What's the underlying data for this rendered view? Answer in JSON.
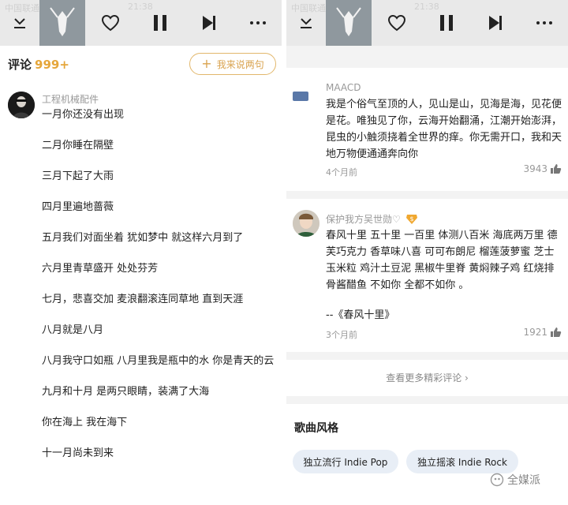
{
  "status_bar": {
    "carrier": "中国联通",
    "time": "21:38"
  },
  "player": {
    "icons": [
      "chevron-down-icon",
      "heart-icon",
      "pause-icon",
      "next-track-icon",
      "more-icon"
    ]
  },
  "left": {
    "comments_label": "评论",
    "comments_count": "999+",
    "say_button": "我来说两句",
    "comment": {
      "user": "工程机械配件",
      "lines": [
        "一月你还没有出现",
        "二月你睡在隔壁",
        "三月下起了大雨",
        "四月里遍地蔷薇",
        "五月我们对面坐着 犹如梦中 就这样六月到了",
        "六月里青草盛开 处处芬芳",
        "七月，悲喜交加 麦浪翻滚连同草地 直到天涯",
        "八月就是八月",
        "八月我守口如瓶 八月里我是瓶中的水 你是青天的云",
        "九月和十月 是两只眼睛，装满了大海",
        "你在海上 我在海下",
        "十一月尚未到来"
      ]
    }
  },
  "right": {
    "comments": [
      {
        "user": "MAACD",
        "text": "我是个俗气至顶的人，见山是山，见海是海，见花便是花。唯独见了你，云海开始翻涌，江潮开始澎湃，昆虫的小触须挠着全世界的痒。你无需开口，我和天地万物便通通奔向你",
        "time": "4个月前",
        "likes": "3943"
      },
      {
        "user": "保护我方吴世勋♡",
        "text": "春风十里 五十里 一百里 体测八百米 海底两万里 德芙巧克力 香草味八喜 可可布朗尼 榴莲菠萝蜜 芝士玉米粒 鸡汁土豆泥 黑椒牛里脊 黄焖辣子鸡 红烧排骨酱醋鱼 不如你 全都不如你 。",
        "quote": "--《春风十里》",
        "time": "3个月前",
        "likes": "1921"
      }
    ],
    "more_comments": "查看更多精彩评论 ›",
    "style_section": "歌曲风格",
    "tags": [
      "独立流行 Indie Pop",
      "独立摇滚 Indie Rock"
    ],
    "watermark": "全媒派"
  }
}
